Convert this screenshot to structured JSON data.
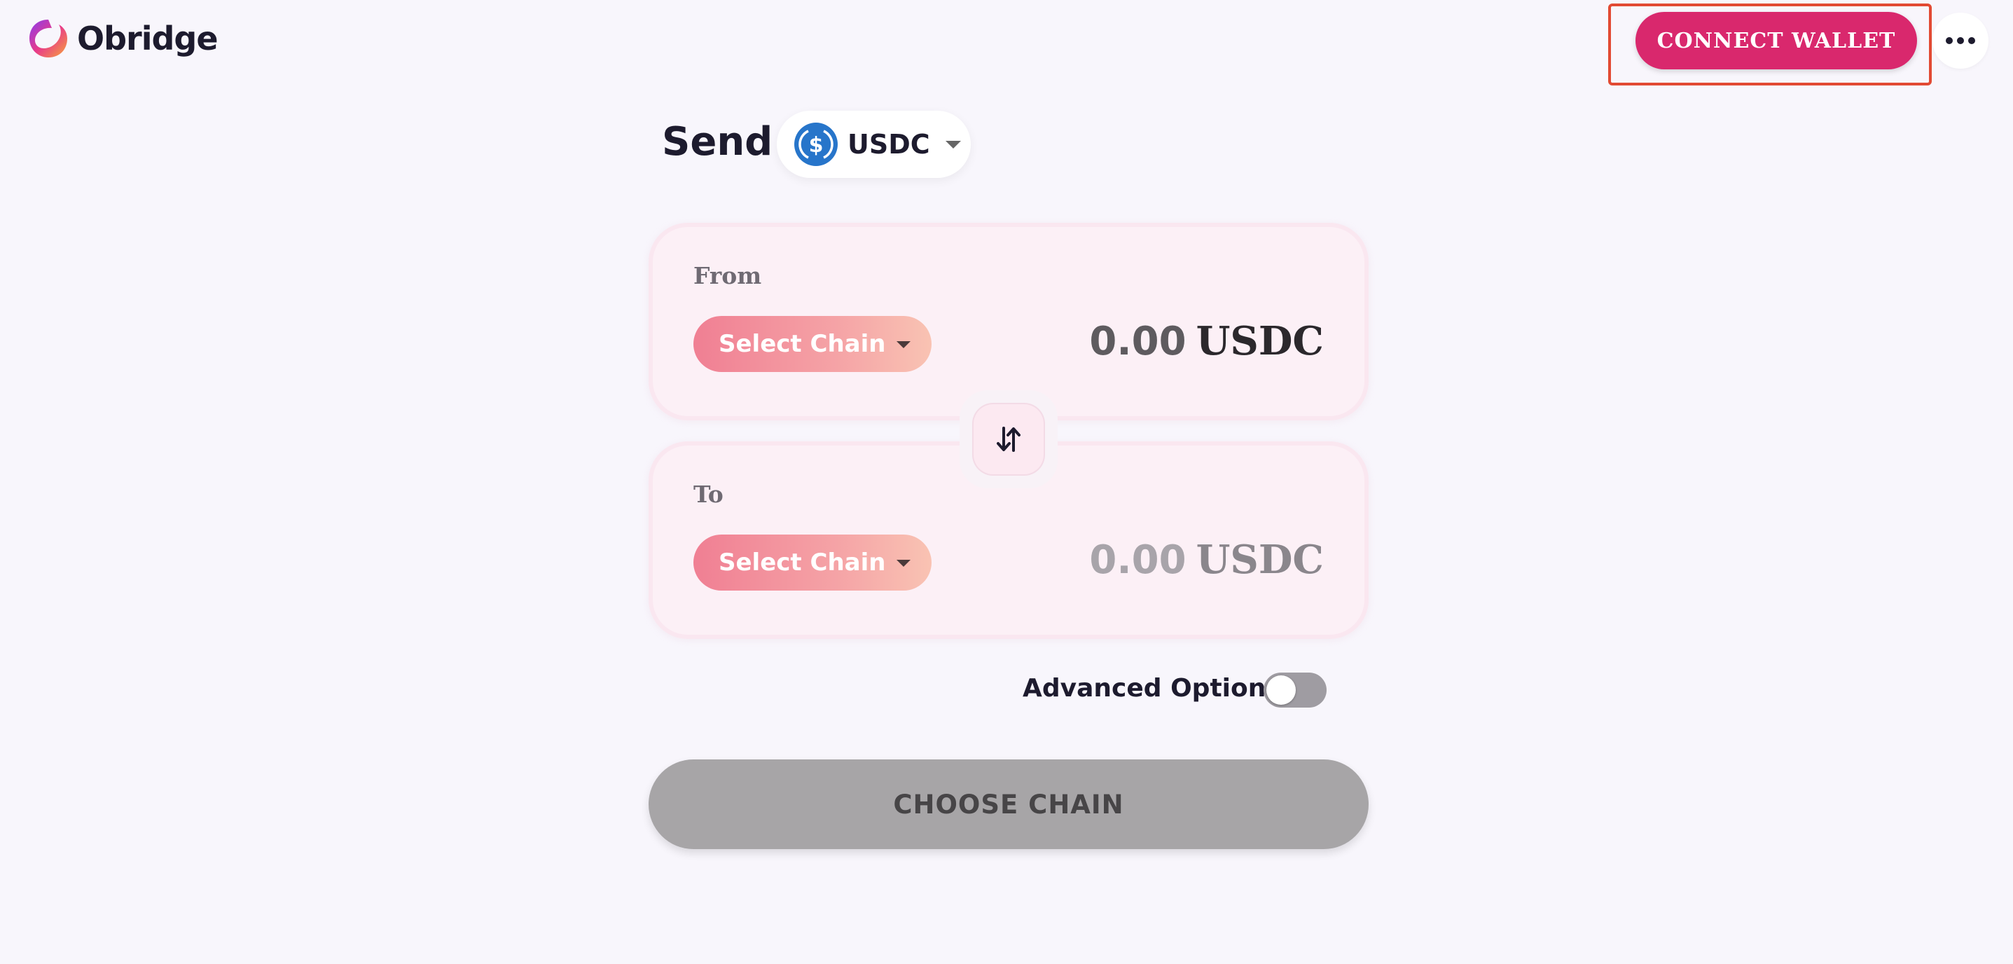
{
  "header": {
    "logo_text": "Obridge",
    "connect_wallet_label": "CONNECT WALLET",
    "more_icon": "ellipsis-icon"
  },
  "send": {
    "title": "Send",
    "token": {
      "symbol": "USDC",
      "icon": "usdc-coin-icon"
    }
  },
  "from_panel": {
    "label": "From",
    "chain_button_label": "Select Chain",
    "amount": "0.00",
    "unit": "USDC"
  },
  "to_panel": {
    "label": "To",
    "chain_button_label": "Select Chain",
    "amount": "0.00",
    "unit": "USDC"
  },
  "swap_icon": "swap-arrows-icon",
  "advanced_options": {
    "label": "Advanced Options",
    "enabled": false
  },
  "primary_action": {
    "label": "CHOOSE CHAIN"
  },
  "colors": {
    "background": "#f8f6fc",
    "accent": "#d9286d",
    "highlight_border": "#e24a33",
    "panel_bg": "#fcf0f6",
    "chain_gradient_start": "#f07f93",
    "chain_gradient_end": "#f9c3b3",
    "disabled_button": "#a7a5a7",
    "usdc_blue": "#2775ca"
  }
}
